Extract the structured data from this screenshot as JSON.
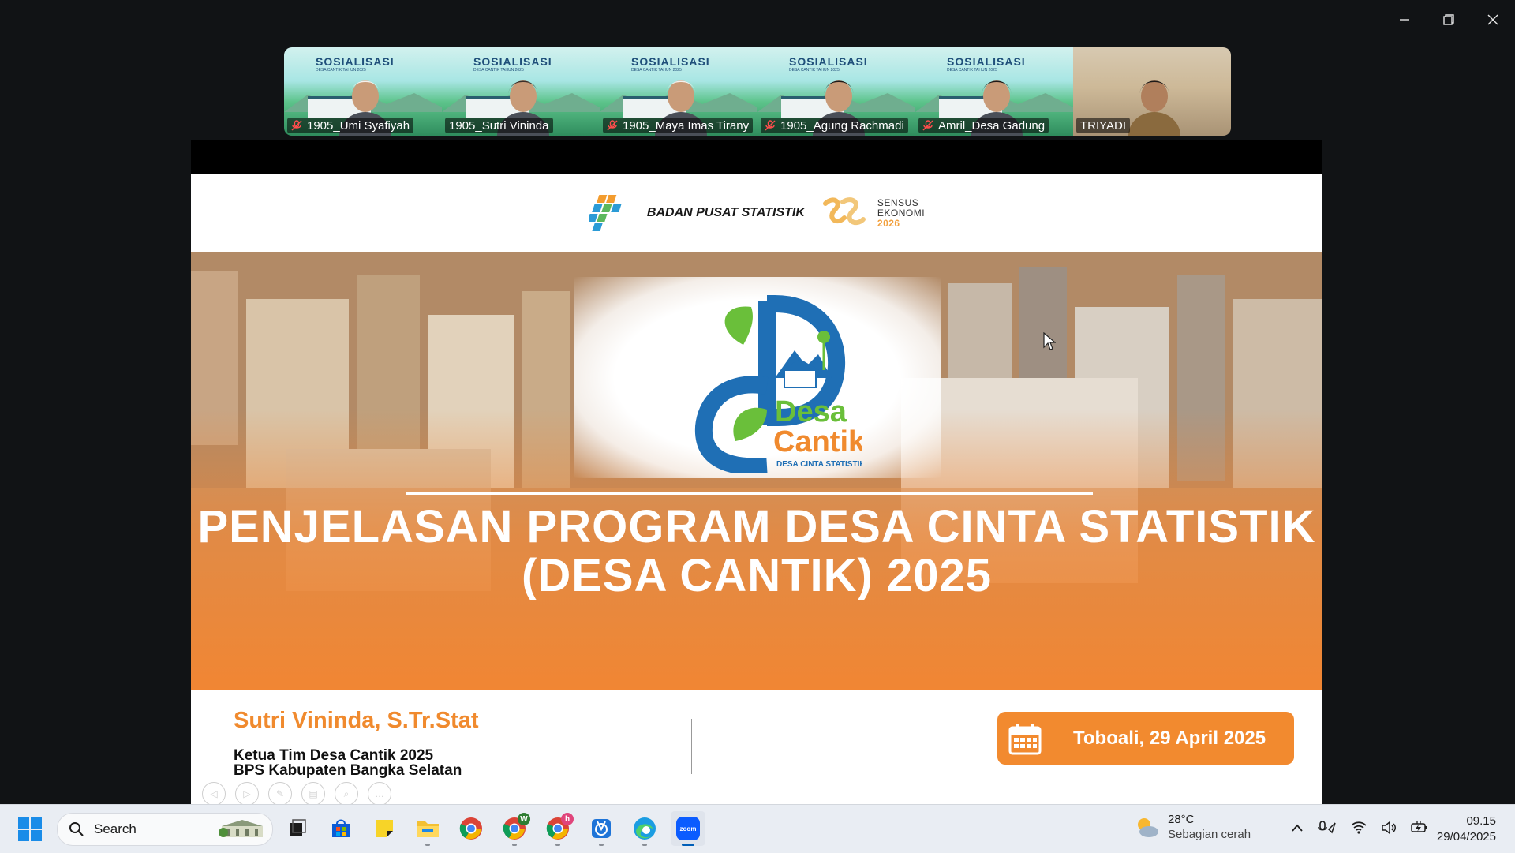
{
  "participants": [
    {
      "name": "1905_Umi Syafiyah",
      "muted": true,
      "active": false,
      "banner_title": "SOSIALISASI",
      "banner_sub": "DESA CANTIK TAHUN 2025"
    },
    {
      "name": "1905_Sutri Vininda",
      "muted": false,
      "active": true,
      "banner_title": "SOSIALISASI",
      "banner_sub": "DESA CANTIK TAHUN 2025"
    },
    {
      "name": "1905_Maya Imas Tirany",
      "muted": true,
      "active": false,
      "banner_title": "SOSIALISASI",
      "banner_sub": "DESA CANTIK TAHUN 2025"
    },
    {
      "name": "1905_Agung Rachmadi",
      "muted": true,
      "active": false,
      "banner_title": "SOSIALISASI",
      "banner_sub": "DESA CANTIK TAHUN 2025"
    },
    {
      "name": "Amril_Desa Gadung",
      "muted": true,
      "active": false,
      "banner_title": "SOSIALISASI",
      "banner_sub": "DESA CANTIK TAHUN 2025"
    },
    {
      "name": "TRIYADI",
      "muted": false,
      "active": false,
      "banner_title": "",
      "banner_sub": ""
    }
  ],
  "slide": {
    "org_name": "BADAN PUSAT STATISTIK",
    "census_line1": "SENSUS",
    "census_line2": "EKONOMI",
    "census_year": "2026",
    "logo_word1": "Desa",
    "logo_word2": "Cantik",
    "logo_tagline": "DESA CINTA STATISTIK",
    "title_line1": "PENJELASAN PROGRAM DESA CINTA STATISTIK",
    "title_line2": "(DESA CANTIK) 2025",
    "presenter": "Sutri Vininda, S.Tr.Stat",
    "role_line1": "Ketua Tim Desa Cantik 2025",
    "role_line2": "BPS Kabupaten Bangka Selatan",
    "date_text": "Toboali, 29 April 2025",
    "colors": {
      "accent": "#f28a2f",
      "logo_blue": "#1f6fb5",
      "logo_green": "#6abf3a"
    }
  },
  "slide_controls": [
    "prev-icon",
    "next-icon",
    "annotate-icon",
    "slides-icon",
    "zoom-icon",
    "more-icon"
  ],
  "taskbar": {
    "search_label": "Search",
    "apps": [
      {
        "name": "task-view",
        "active": false,
        "running": false
      },
      {
        "name": "microsoft-store",
        "active": false,
        "running": false
      },
      {
        "name": "sticky-notes",
        "active": false,
        "running": false
      },
      {
        "name": "file-explorer",
        "active": false,
        "running": true
      },
      {
        "name": "chrome",
        "active": false,
        "running": false
      },
      {
        "name": "chrome-profile-w",
        "active": false,
        "running": true,
        "badge": "W"
      },
      {
        "name": "chrome-profile-h",
        "active": false,
        "running": true,
        "badge": "h"
      },
      {
        "name": "snipping-tool",
        "active": false,
        "running": true
      },
      {
        "name": "edge",
        "active": false,
        "running": true
      },
      {
        "name": "zoom",
        "active": true,
        "running": true,
        "label": "zoom"
      }
    ],
    "weather_temp": "28°C",
    "weather_cond": "Sebagian cerah",
    "time": "09.15",
    "date": "29/04/2025"
  }
}
